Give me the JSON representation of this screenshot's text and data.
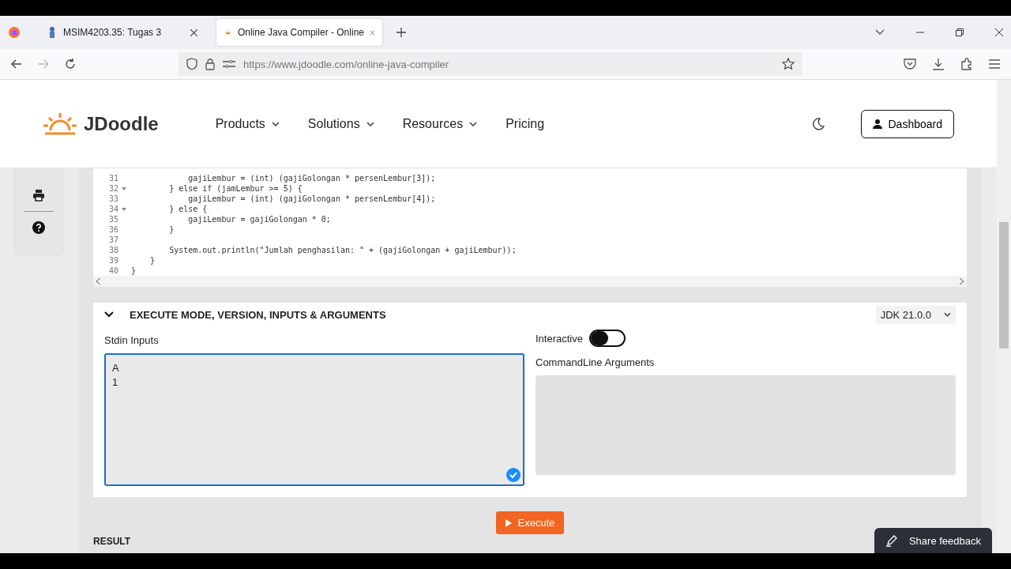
{
  "browser": {
    "tabs": [
      {
        "title": "MSIM4203.35: Tugas 3",
        "selected": false
      },
      {
        "title": "Online Java Compiler - Online",
        "selected": true
      }
    ],
    "url": {
      "host": "https://www.jdoodle.com",
      "path": "/online-java-compiler"
    }
  },
  "header": {
    "logo": "JDoodle",
    "nav": [
      {
        "label": "Products",
        "dropdown": true
      },
      {
        "label": "Solutions",
        "dropdown": true
      },
      {
        "label": "Resources",
        "dropdown": true
      },
      {
        "label": "Pricing",
        "dropdown": false
      }
    ],
    "dashboard": "Dashboard"
  },
  "editor": {
    "lines": [
      {
        "no": "31",
        "fold": false,
        "code": "            gajiLembur = (int) (gajiGolongan * persenLembur[3]);"
      },
      {
        "no": "32",
        "fold": true,
        "code": "        } else if (jamLembur >= 5) {"
      },
      {
        "no": "33",
        "fold": false,
        "code": "            gajiLembur = (int) (gajiGolongan * persenLembur[4]);"
      },
      {
        "no": "34",
        "fold": true,
        "code": "        } else {"
      },
      {
        "no": "35",
        "fold": false,
        "code": "            gajiLembur = gajiGolongan * 0;"
      },
      {
        "no": "36",
        "fold": false,
        "code": "        }"
      },
      {
        "no": "37",
        "fold": false
      },
      {
        "no": "38",
        "fold": false,
        "code": "        System.out.println(\"Jumlah penghasilan: \" + (gajiGolongan + gajiLembur));"
      },
      {
        "no": "39",
        "fold": false,
        "code": "    }"
      },
      {
        "no": "40",
        "fold": false,
        "code": "}"
      }
    ]
  },
  "execute_panel": {
    "title": "EXECUTE MODE, VERSION, INPUTS & ARGUMENTS",
    "expanded": true,
    "version": "JDK 21.0.0",
    "stdin_label": "Stdin Inputs",
    "stdin_value": "A\n1",
    "interactive_label": "Interactive",
    "interactive": {
      "on": false
    },
    "args_label": "CommandLine Arguments"
  },
  "execute_button": "Execute",
  "result_label": "RESULT",
  "feedback_button": "Share feedback"
}
